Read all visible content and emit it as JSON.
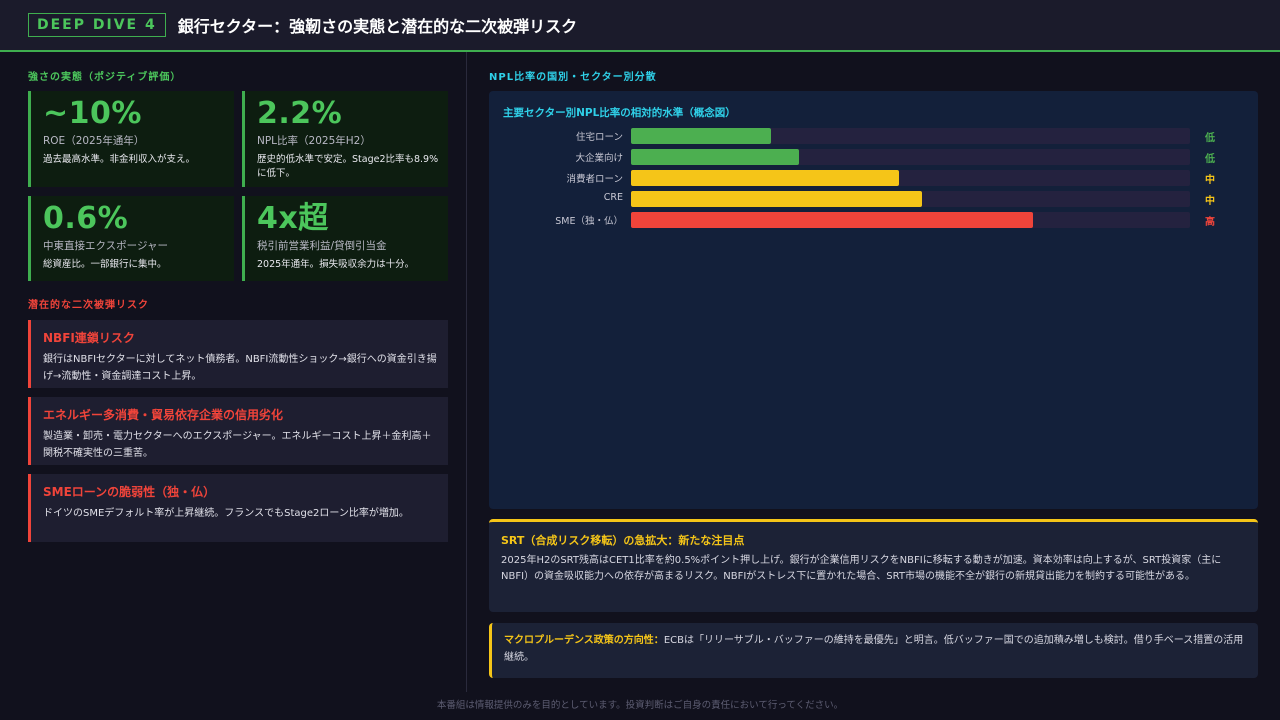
{
  "header": {
    "badge": "DEEP DIVE 4",
    "title": "銀行セクター：強靭さの実態と潜在的な二次被弾リスク"
  },
  "strengths": {
    "label": "強さの実態（ポジティブ評価）",
    "kpis": [
      {
        "value": "~10%",
        "label": "ROE（2025年通年）",
        "desc": "過去最高水準。非金利収入が支え。"
      },
      {
        "value": "2.2%",
        "label": "NPL比率（2025年H2）",
        "desc": "歴史的低水準で安定。Stage2比率も8.9%に低下。"
      },
      {
        "value": "0.6%",
        "label": "中東直接エクスポージャー",
        "desc": "総資産比。一部銀行に集中。"
      },
      {
        "value": "4x超",
        "label": "税引前営業利益/貸倒引当金",
        "desc": "2025年通年。損失吸収余力は十分。"
      }
    ]
  },
  "risks": {
    "label": "潜在的な二次被弾リスク",
    "items": [
      {
        "title": "NBFI連鎖リスク",
        "desc": "銀行はNBFIセクターに対してネット債務者。NBFI流動性ショック→銀行への資金引き揚げ→流動性・資金調達コスト上昇。"
      },
      {
        "title": "エネルギー多消費・貿易依存企業の信用劣化",
        "desc": "製造業・卸売・電力セクターへのエクスポージャー。エネルギーコスト上昇＋金利高＋関税不確実性の三重苦。"
      },
      {
        "title": "SMEローンの脆弱性（独・仏）",
        "desc": "ドイツのSMEデフォルト率が上昇継続。フランスでもStage2ローン比率が増加。"
      }
    ]
  },
  "npl": {
    "label": "NPL比率の国別・セクター別分散",
    "chart_data": {
      "type": "bar",
      "title": "主要セクター別NPL比率の相対的水準（概念図）",
      "categories": [
        "住宅ローン",
        "大企業向け",
        "消費者ローン",
        "CRE",
        "SME（独・仏）"
      ],
      "values": [
        25,
        30,
        48,
        52,
        72
      ],
      "levels": [
        "低",
        "低",
        "中",
        "中",
        "高"
      ],
      "colors": [
        "#4caf50",
        "#4caf50",
        "#f5c518",
        "#f5c518",
        "#f0443a"
      ],
      "ylim": [
        0,
        100
      ]
    }
  },
  "srt": {
    "title": "SRT（合成リスク移転）の急拡大：新たな注目点",
    "desc": "2025年H2のSRT残高はCET1比率を約0.5%ポイント押し上げ。銀行が企業信用リスクをNBFIに移転する動きが加速。資本効率は向上するが、SRT投資家（主にNBFI）の資金吸収能力への依存が高まるリスク。NBFIがストレス下に置かれた場合、SRT市場の機能不全が銀行の新規貸出能力を制約する可能性がある。"
  },
  "macro": {
    "title": "マクロプルーデンス政策の方向性：",
    "desc": "ECBは「リリーサブル・バッファーの維持を最優先」と明言。低バッファー国での追加積み増しも検討。借り手ベース措置の活用継続。"
  },
  "footer": "本番組は情報提供のみを目的としています。投資判断はご自身の責任において行ってください。"
}
